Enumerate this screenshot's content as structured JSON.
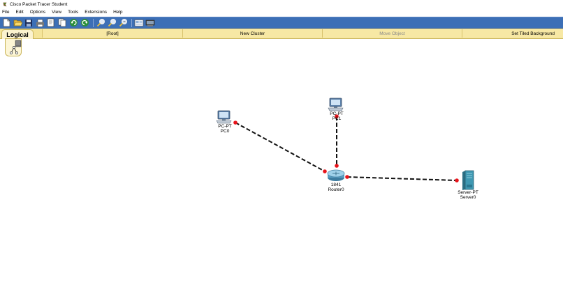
{
  "window": {
    "title": "Cisco Packet Tracer Student"
  },
  "menu": {
    "items": [
      "File",
      "Edit",
      "Options",
      "View",
      "Tools",
      "Extensions",
      "Help"
    ]
  },
  "toolbar": {
    "buttons": [
      "new-icon",
      "open-icon",
      "save-icon",
      "print-icon",
      "activity-wizard-icon",
      "copy-icon",
      "undo-icon",
      "redo-icon",
      "zoom-in-icon",
      "zoom-reset-icon",
      "zoom-out-icon",
      "palette-icon",
      "custom-device-icon"
    ]
  },
  "workspace": {
    "tab_label": "Logical",
    "root_label": "[Root]",
    "new_cluster_label": "New Cluster",
    "move_object_label": "Move Object",
    "set_tiled_background_label": "Set Tiled Background"
  },
  "devices": {
    "pc0": {
      "model": "PC-PT",
      "name": "PC0"
    },
    "pc1": {
      "model": "PC-PT",
      "name": "PC1"
    },
    "router0": {
      "model": "1841",
      "name": "Router0"
    },
    "server0": {
      "model": "Server-PT",
      "name": "Server0"
    }
  },
  "colors": {
    "toolbar": "#3c6fb6",
    "workspace_bar": "#f5e59a",
    "link_endpoint": "#e8141b",
    "link_line": "#111111"
  }
}
